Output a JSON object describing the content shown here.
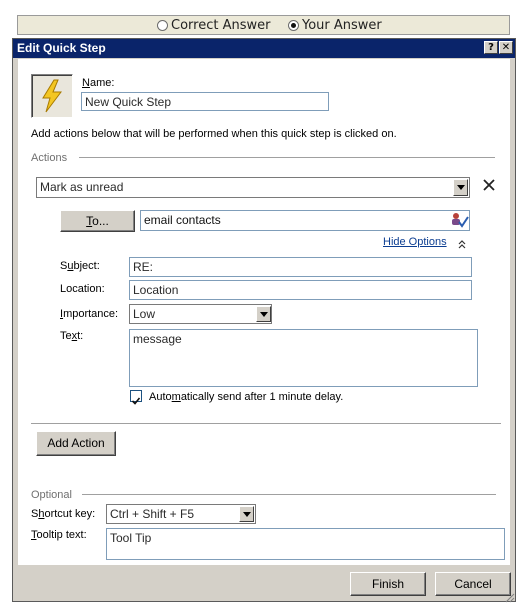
{
  "answer_toggle": {
    "correct_label": "Correct Answer",
    "your_label": "Your Answer",
    "selected": "Your Answer"
  },
  "dialog": {
    "title": "Edit Quick Step",
    "help_glyph": "?",
    "close_glyph": "✕"
  },
  "name": {
    "label": "Name:",
    "value": "New Quick Step"
  },
  "instructions": "Add actions below that will be performed when this quick step is clicked on.",
  "actions_section": {
    "label": "Actions"
  },
  "action": {
    "selected": "Mark as unread",
    "remove_glyph": "✕",
    "to_button": "To...",
    "to_value": "email contacts",
    "hide_options": "Hide Options",
    "hide_options_glyph": "⌃"
  },
  "fields": {
    "subject_label": "Subject:",
    "subject_value": "RE:",
    "location_label": "Location:",
    "location_value": "Location",
    "importance_label": "Importance:",
    "importance_value": "Low",
    "text_label": "Text:",
    "text_value": "message",
    "auto_send_label": "Automatically send after 1 minute delay.",
    "auto_send_checked": true
  },
  "add_action_button": "Add Action",
  "optional_section": {
    "label": "Optional"
  },
  "shortcut": {
    "label": "Shortcut key:",
    "value": "Ctrl + Shift + F5"
  },
  "tooltip": {
    "label": "Tooltip text:",
    "value": "Tool Tip"
  },
  "footer": {
    "finish": "Finish",
    "cancel": "Cancel"
  },
  "colors": {
    "titlebar": "#0a246a",
    "dialog_bg": "#d4d0c8",
    "link": "#0b3d91"
  }
}
